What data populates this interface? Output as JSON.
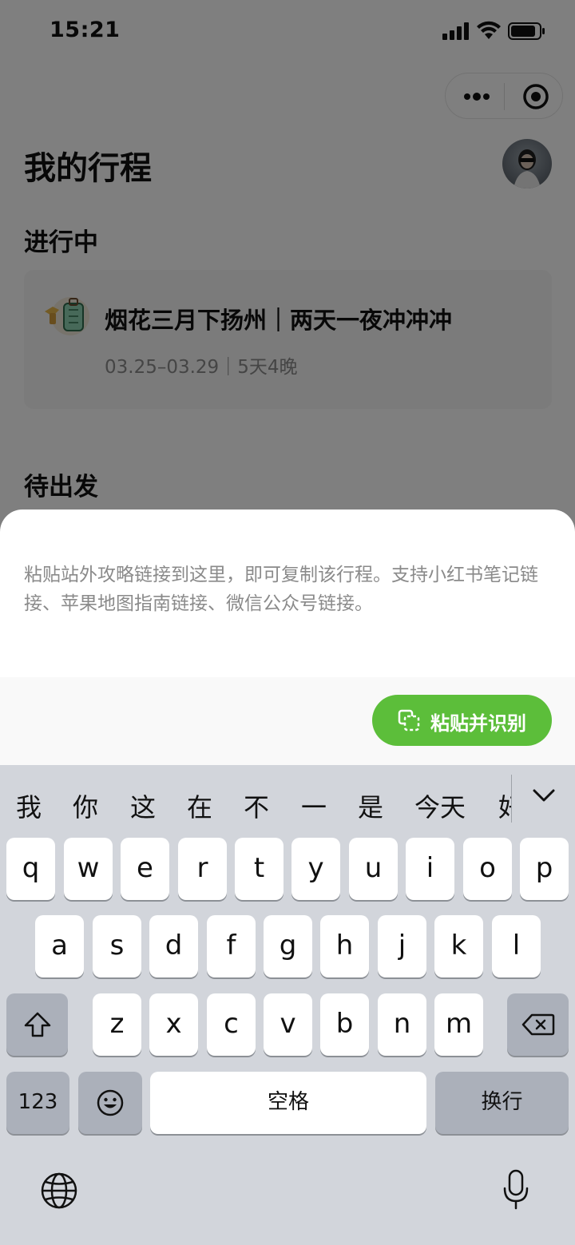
{
  "status_bar": {
    "time": "15:21"
  },
  "capsule": {
    "more_icon": "more-dots-icon",
    "close_icon": "target-circle-icon"
  },
  "page": {
    "title": "我的行程",
    "section_ongoing": "进行中",
    "trip": {
      "title": "烟花三月下扬州｜两天一夜冲冲冲",
      "meta": "03.25–03.29｜5天4晚"
    },
    "section_upcoming": "待出发"
  },
  "sheet": {
    "hint": "粘贴站外攻略链接到这里，即可复制该行程。支持小红书笔记链接、苹果地图指南链接、微信公众号链接。",
    "paste_button": "粘贴并识别"
  },
  "keyboard": {
    "candidates": [
      "我",
      "你",
      "这",
      "在",
      "不",
      "一",
      "是",
      "今天",
      "好"
    ],
    "row1": [
      "q",
      "w",
      "e",
      "r",
      "t",
      "y",
      "u",
      "i",
      "o",
      "p"
    ],
    "row2": [
      "a",
      "s",
      "d",
      "f",
      "g",
      "h",
      "j",
      "k",
      "l"
    ],
    "row3": [
      "z",
      "x",
      "c",
      "v",
      "b",
      "n",
      "m"
    ],
    "numbers_key": "123",
    "space_key": "空格",
    "return_key": "换行"
  },
  "colors": {
    "accent_green": "#5cbe3a",
    "overlay": "rgba(0,0,0,0.5)",
    "keyboard_bg": "#d2d5db"
  }
}
